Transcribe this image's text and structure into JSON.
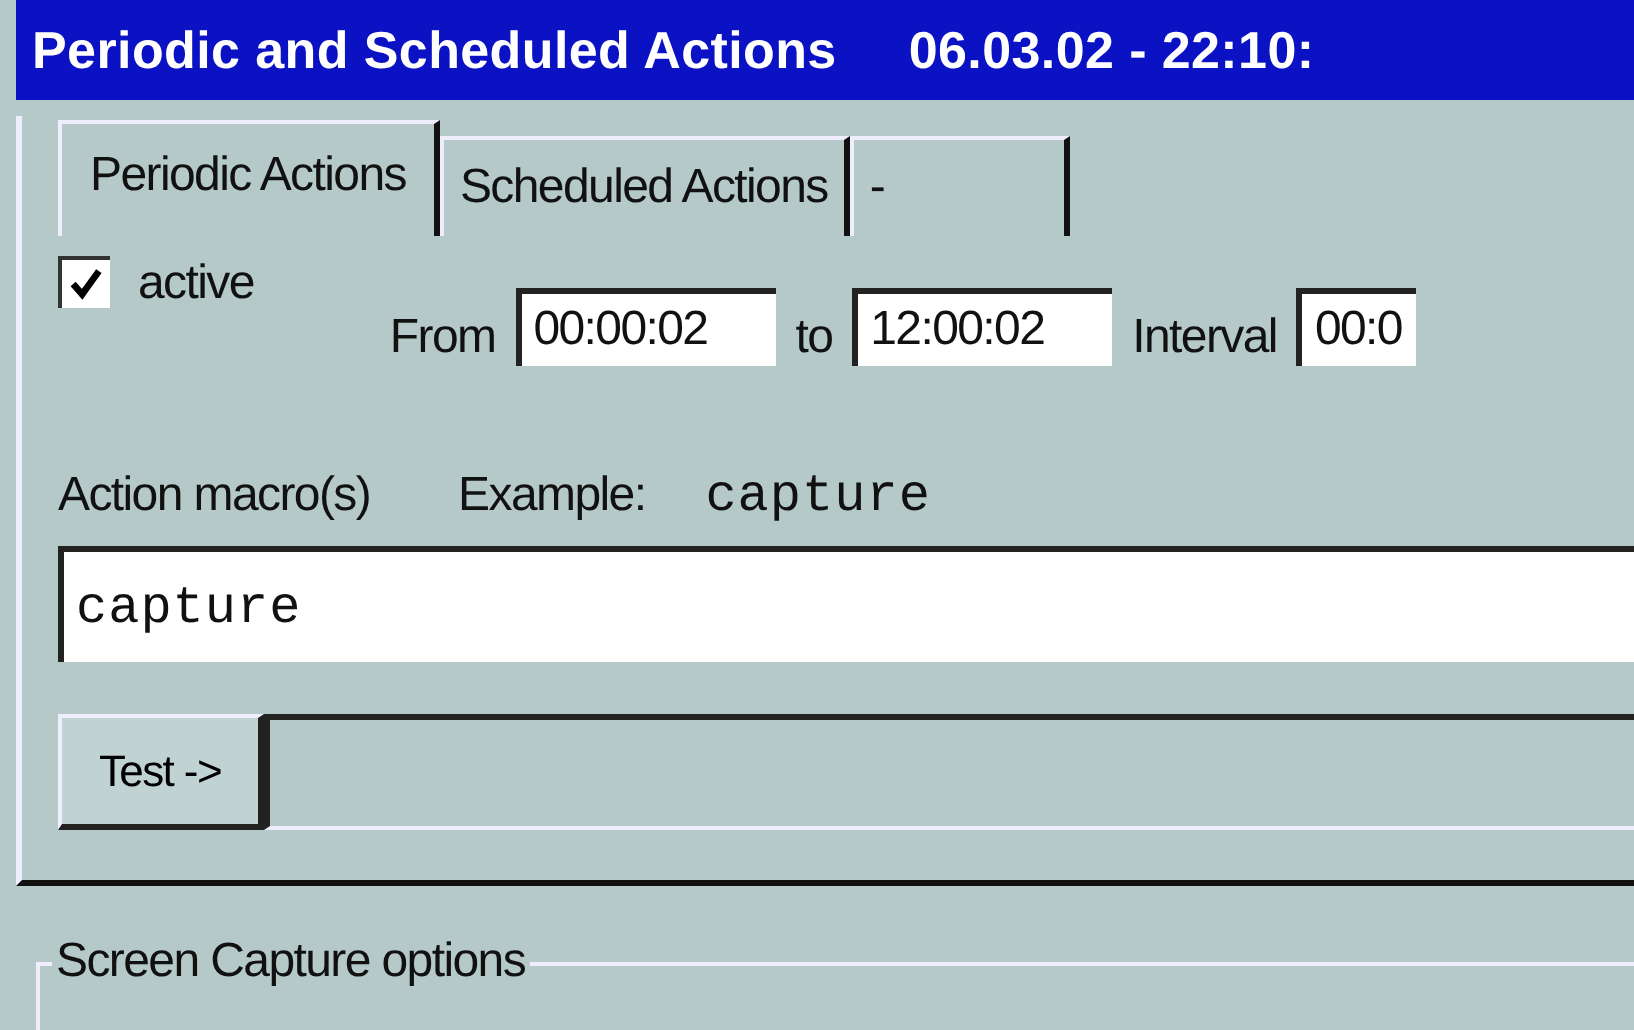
{
  "window": {
    "title": "Periodic and Scheduled Actions",
    "datetime": "06.03.02 - 22:10:"
  },
  "tabs": [
    {
      "label": "Periodic Actions",
      "selected": true
    },
    {
      "label": "Scheduled Actions",
      "selected": false
    },
    {
      "label": "-",
      "selected": false
    }
  ],
  "active": {
    "label": "active",
    "checked": true
  },
  "from": {
    "label": "From",
    "value": "00:00:02"
  },
  "to": {
    "label": "to",
    "value": "12:00:02"
  },
  "interval": {
    "label": "Interval",
    "value": "00:0"
  },
  "macro": {
    "label": "Action macro(s)",
    "example_label": "Example:",
    "example": "capture",
    "value": "capture"
  },
  "test": {
    "button": "Test ->"
  },
  "group": {
    "title": "Screen Capture options"
  }
}
